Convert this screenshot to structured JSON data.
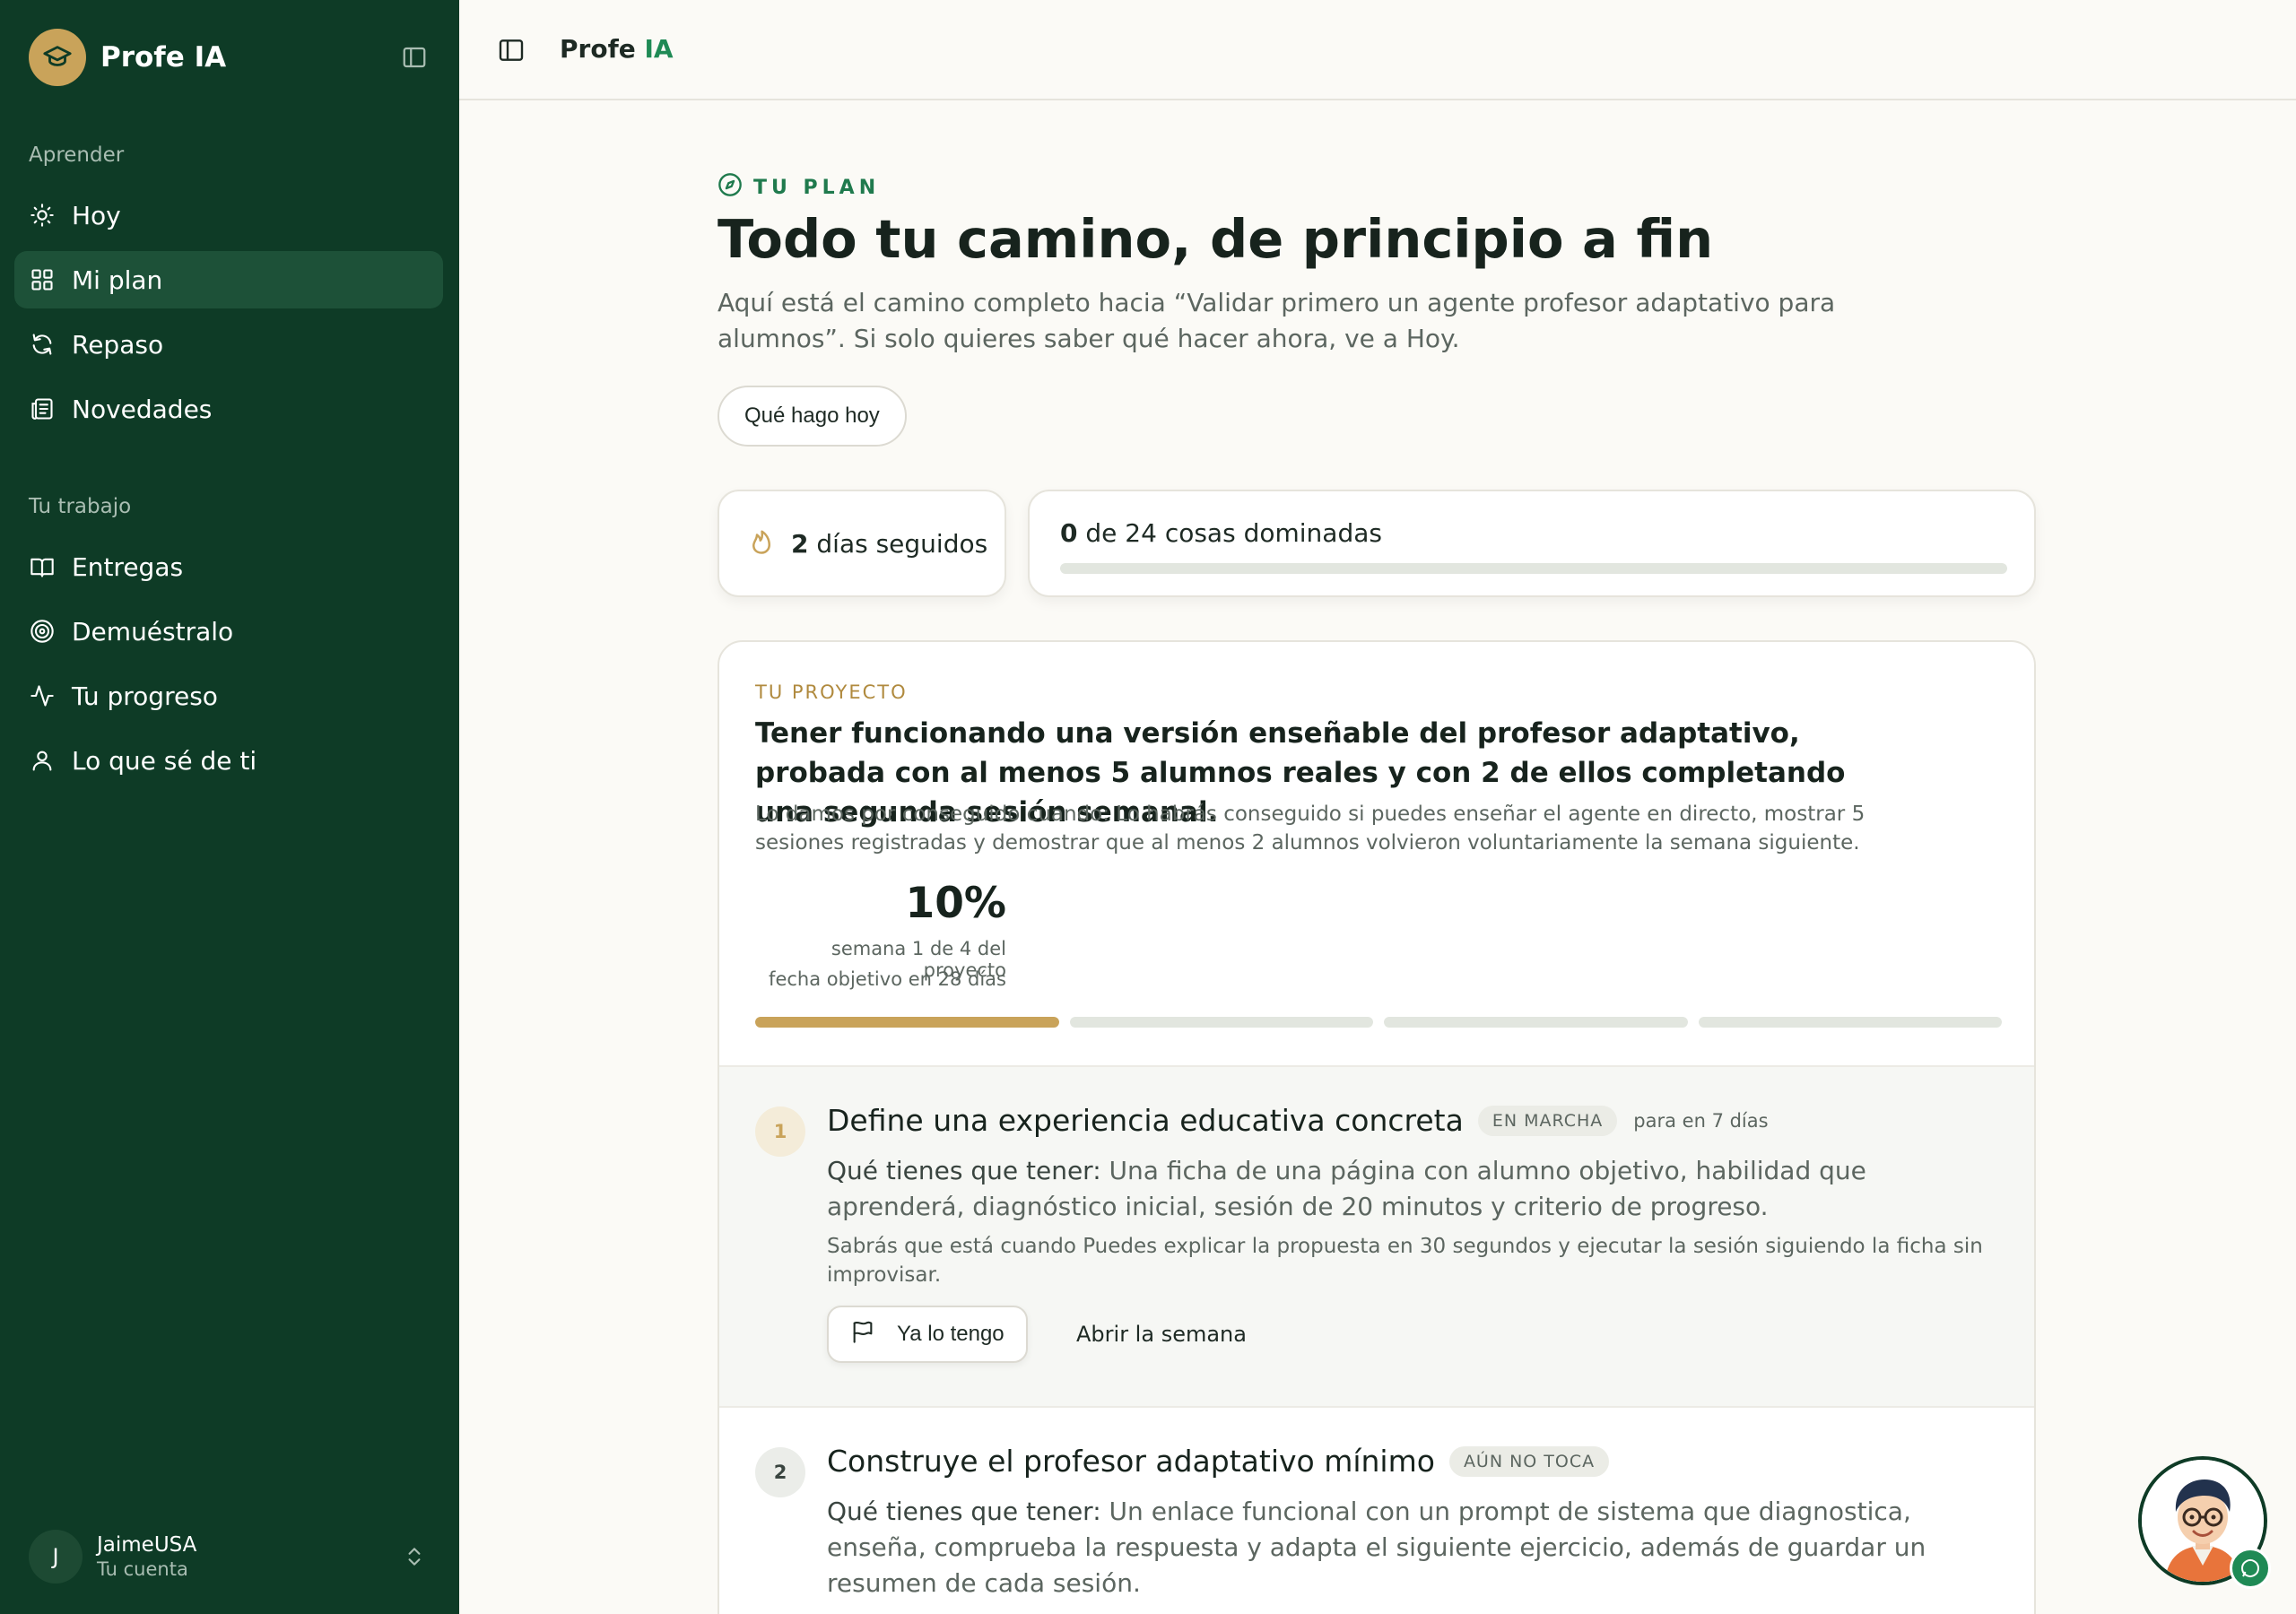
{
  "app": {
    "brand_name": "Profe IA",
    "topbar_title_main": "Profe",
    "topbar_title_accent": "IA"
  },
  "sidebar": {
    "section_learn": "Aprender",
    "section_work": "Tu trabajo",
    "learn_items": [
      {
        "label": "Hoy",
        "icon": "sun-icon"
      },
      {
        "label": "Mi plan",
        "icon": "grid-icon",
        "active": true
      },
      {
        "label": "Repaso",
        "icon": "refresh-icon"
      },
      {
        "label": "Novedades",
        "icon": "newspaper-icon"
      }
    ],
    "work_items": [
      {
        "label": "Entregas",
        "icon": "book-open-icon"
      },
      {
        "label": "Demuéstralo",
        "icon": "target-icon"
      },
      {
        "label": "Tu progreso",
        "icon": "activity-icon"
      },
      {
        "label": "Lo que sé de ti",
        "icon": "user-icon"
      }
    ],
    "account": {
      "initial": "J",
      "name": "JaimeUSA",
      "subtitle": "Tu cuenta"
    }
  },
  "plan": {
    "eyebrow": "TU PLAN",
    "title": "Todo tu camino, de principio a fin",
    "subtitle": "Aquí está el camino completo hacia “Validar primero un agente profesor adaptativo para alumnos”. Si solo quieres saber qué hacer ahora, ve a Hoy.",
    "today_button": "Qué hago hoy"
  },
  "stats": {
    "streak_value": "2",
    "streak_label": "días seguidos",
    "mastered_value": "0",
    "mastered_label": "de 24 cosas dominadas",
    "mastered_fraction": 0
  },
  "project": {
    "label": "TU PROYECTO",
    "title": "Tener funcionando una versión enseñable del profesor adaptativo, probada con al menos 5 alumnos reales y con 2 de ellos completando una segunda sesión semanal.",
    "criteria": "Lo damos por conseguido cuando: Lo habrás conseguido si puedes enseñar el agente en directo, mostrar 5 sesiones registradas y demostrar que al menos 2 alumnos volvieron voluntariamente la semana siguiente.",
    "percent": "10%",
    "week_text": "semana 1 de 4 del proyecto",
    "deadline_text": "fecha objetivo en 28 días",
    "weeks_total": 4,
    "weeks_done": 1
  },
  "milestones": [
    {
      "number": "1",
      "title": "Define una experiencia educativa concreta",
      "badge": "EN MARCHA",
      "due": "para en 7 días",
      "need_lead": "Qué tienes que tener:",
      "need_text": "Una ficha de una página con alumno objetivo, habilidad que aprenderá, diagnóstico inicial, sesión de 20 minutos y criterio de progreso.",
      "know_text": "Sabrás que está cuando Puedes explicar la propuesta en 30 segundos y ejecutar la sesión siguiendo la ficha sin improvisar.",
      "have_button": "Ya lo tengo",
      "open_week": "Abrir la semana"
    },
    {
      "number": "2",
      "title": "Construye el profesor adaptativo mínimo",
      "badge": "AÚN NO TOCA",
      "need_lead": "Qué tienes que tener:",
      "need_text": "Un enlace funcional con un prompt de sistema que diagnostica, enseña, comprueba la respuesta y adapta el siguiente ejercicio, además de guardar un resumen de cada sesión."
    }
  ],
  "colors": {
    "sidebar_bg": "#0e3b26",
    "accent_green": "#1f8a55",
    "accent_gold": "#c9a35a",
    "page_bg": "#fbfaf6"
  },
  "assistant": {
    "icon": "tutor-avatar-icon",
    "badge_icon": "chat-bubble-icon"
  }
}
